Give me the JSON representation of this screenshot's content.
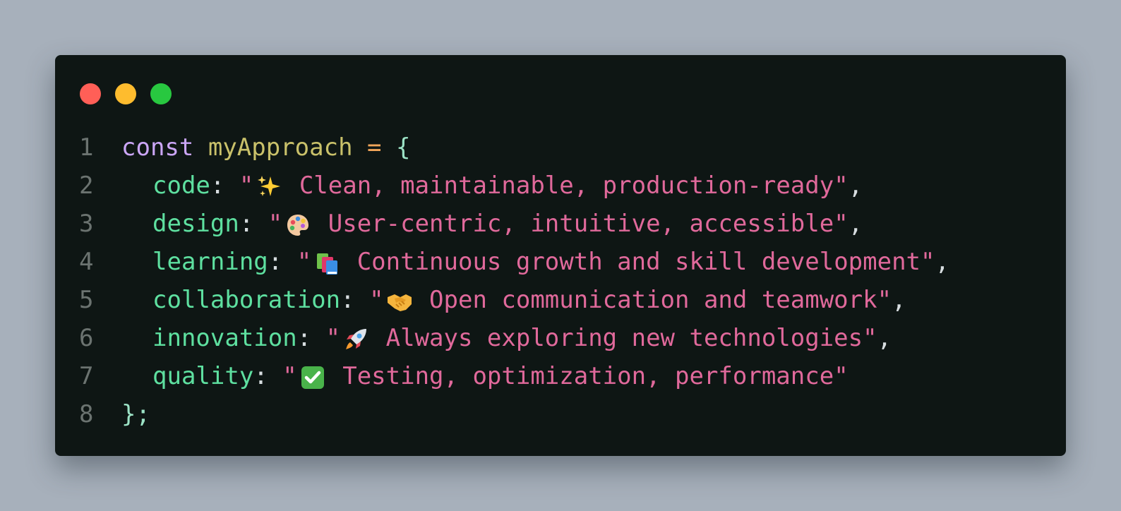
{
  "window": {
    "traffic_lights": [
      {
        "name": "close",
        "color": "#ff5f57"
      },
      {
        "name": "minimize",
        "color": "#febc2e"
      },
      {
        "name": "maximize",
        "color": "#28c840"
      }
    ]
  },
  "code": {
    "line_numbers": [
      "1",
      "2",
      "3",
      "4",
      "5",
      "6",
      "7",
      "8"
    ],
    "keyword": "const",
    "variable": "myApproach",
    "operator": "=",
    "open_brace": "{",
    "close": "};",
    "entries": [
      {
        "key": "code",
        "emoji_icon": "sparkles-icon",
        "text": "Clean, maintainable, production-ready",
        "trailing": ","
      },
      {
        "key": "design",
        "emoji_icon": "palette-icon",
        "text": "User-centric, intuitive, accessible",
        "trailing": ","
      },
      {
        "key": "learning",
        "emoji_icon": "books-icon",
        "text": "Continuous growth and skill development",
        "trailing": ","
      },
      {
        "key": "collaboration",
        "emoji_icon": "handshake-icon",
        "text": "Open communication and teamwork",
        "trailing": ","
      },
      {
        "key": "innovation",
        "emoji_icon": "rocket-icon",
        "text": "Always exploring new technologies",
        "trailing": ","
      },
      {
        "key": "quality",
        "emoji_icon": "check-mark-button-icon",
        "text": "Testing, optimization, performance",
        "trailing": ""
      }
    ],
    "colors": {
      "keyword": "#cba6f7",
      "variable": "#c9c16a",
      "key": "#5ee0a0",
      "string": "#e0699b",
      "line_number": "#6b7370",
      "background": "#0e1614"
    }
  }
}
